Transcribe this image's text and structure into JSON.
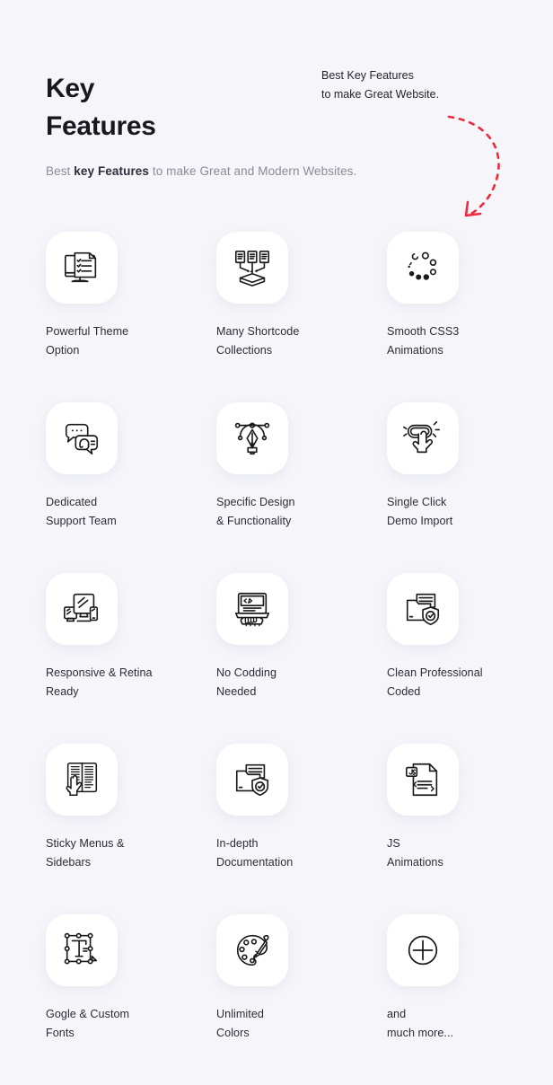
{
  "header": {
    "title_line1": "Key",
    "title_line2": "Features",
    "subtitle_prefix": "Best ",
    "subtitle_bold": "key Features",
    "subtitle_suffix": " to make Great and Modern Websites."
  },
  "annotation": {
    "line1": "Best Key Features",
    "line2": "to make Great Website.",
    "arrow_color": "#f02a3c",
    "arrow_style": "dashed-curved-arrow-down-left"
  },
  "colors": {
    "background": "#f5f5fa",
    "card": "#ffffff",
    "title": "#18181f",
    "label": "#2c2c36",
    "subtitle": "#8b8b99",
    "icon_stroke": "#1a1a1a",
    "accent_red": "#f02a3c"
  },
  "features": [
    {
      "icon": "monitor-checklist-icon",
      "label": "Powerful Theme\nOption"
    },
    {
      "icon": "documents-to-box-icon",
      "label": "Many Shortcode\nCollections"
    },
    {
      "icon": "loading-spinner-dots-icon",
      "label": "Smooth CSS3\nAnimations"
    },
    {
      "icon": "chat-headset-support-icon",
      "label": "Dedicated\nSupport Team"
    },
    {
      "icon": "pen-tool-bezier-icon",
      "label": "Specific Design\n&  Functionality"
    },
    {
      "icon": "hand-click-button-icon",
      "label": "Single Click\nDemo Import"
    },
    {
      "icon": "responsive-devices-icon",
      "label": "Responsive & Retina\nReady"
    },
    {
      "icon": "laptop-code-hands-icon",
      "label": "No Codding\nNeeded"
    },
    {
      "icon": "folder-shield-check-icon",
      "label": "Clean Professional\nCoded"
    },
    {
      "icon": "sticky-menus-sidebars-icon",
      "label": "Sticky Menus &\nSidebars"
    },
    {
      "icon": "documentation-folder-shield-icon",
      "label": "In-depth\nDocumentation"
    },
    {
      "icon": "js-file-icon",
      "label": "JS\nAnimations"
    },
    {
      "icon": "text-transform-fonts-icon",
      "label": "Gogle & Custom\nFonts"
    },
    {
      "icon": "color-palette-brush-icon",
      "label": "Unlimited\nColors"
    },
    {
      "icon": "plus-circle-icon",
      "label": "and\nmuch more..."
    }
  ]
}
